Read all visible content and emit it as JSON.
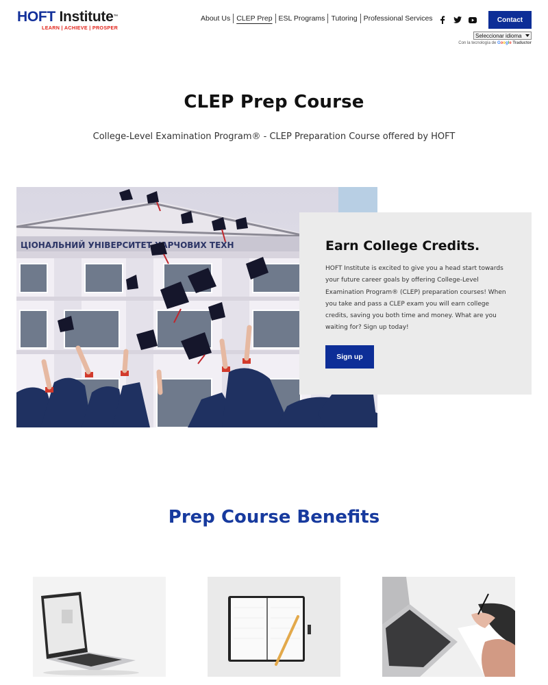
{
  "brand": {
    "name_part1": "HOFT",
    "name_part2": "Institute",
    "trademark": "™",
    "tagline": "LEARN | ACHIEVE | PROSPER",
    "colors": {
      "primary": "#0d2e97",
      "accent": "#e2231a",
      "card_bg": "#ebebeb",
      "heading_blue": "#173a9e"
    }
  },
  "nav": {
    "items": [
      {
        "label": "About Us",
        "active": false
      },
      {
        "label": "CLEP Prep",
        "active": true
      },
      {
        "label": "ESL Programs",
        "active": false
      },
      {
        "label": "Tutoring",
        "active": false
      },
      {
        "label": "Professional Services",
        "active": false
      }
    ],
    "social": [
      "facebook-icon",
      "twitter-icon",
      "youtube-icon"
    ],
    "contact_label": "Contact"
  },
  "translate": {
    "select_value": "Seleccionar idioma",
    "powered_prefix": "Con la tecnología de",
    "google": "Google",
    "product": "Traductor"
  },
  "hero": {
    "title": "CLEP Prep Course",
    "subtitle": "College-Level Examination Program® - CLEP Preparation Course offered by HOFT",
    "image_alt": "graduates throwing caps in front of university building"
  },
  "credits_card": {
    "title": "Earn College Credits.",
    "body": "HOFT Institute is excited to give you a head start towards your future career goals by offering College-Level Examination Program® (CLEP) preparation courses! When you take and pass a CLEP exam you will earn college credits, saving you both time and money. What are you waiting for? Sign up today!",
    "button_label": "Sign up"
  },
  "benefits": {
    "title": "Prep Course Benefits",
    "images": [
      "laptop-photo",
      "notebook-photo",
      "laptop-writing-photo"
    ]
  }
}
